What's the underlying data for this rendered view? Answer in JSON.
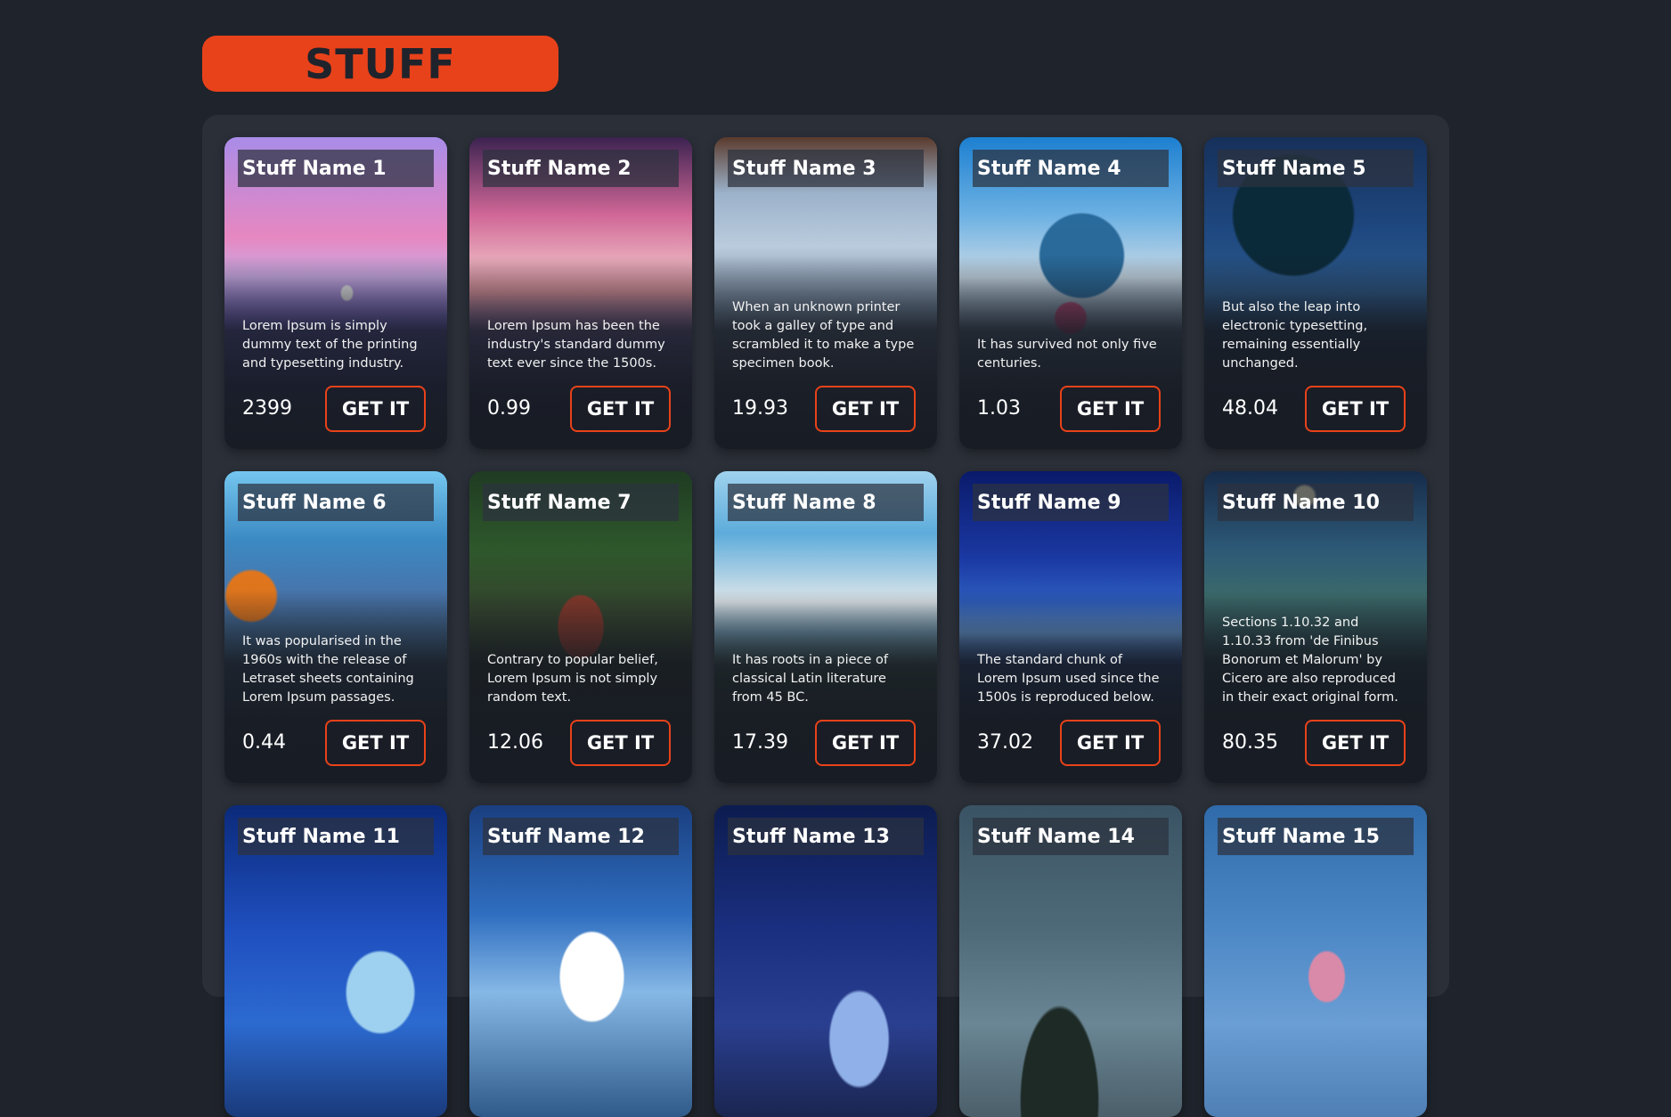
{
  "header": {
    "title": "STUFF"
  },
  "colors": {
    "accent": "#e8421a",
    "background": "#1f232b",
    "panel": "#2a2f38"
  },
  "cards": [
    {
      "name": "Stuff Name 1",
      "description": "Lorem Ipsum is simply dummy text of the printing and typesetting industry.",
      "price": "2399",
      "button": "GET IT"
    },
    {
      "name": "Stuff Name 2",
      "description": "Lorem Ipsum has been the industry's standard dummy text ever since the 1500s.",
      "price": "0.99",
      "button": "GET IT"
    },
    {
      "name": "Stuff Name 3",
      "description": "When an unknown printer took a galley of type and scrambled it to make a type specimen book.",
      "price": "19.93",
      "button": "GET IT"
    },
    {
      "name": "Stuff Name 4",
      "description": "It has survived not only five centuries.",
      "price": "1.03",
      "button": "GET IT"
    },
    {
      "name": "Stuff Name 5",
      "description": "But also the leap into electronic typesetting, remaining essentially unchanged.",
      "price": "48.04",
      "button": "GET IT"
    },
    {
      "name": "Stuff Name 6",
      "description": "It was popularised in the 1960s with the release of Letraset sheets containing Lorem Ipsum passages.",
      "price": "0.44",
      "button": "GET IT"
    },
    {
      "name": "Stuff Name 7",
      "description": "Contrary to popular belief, Lorem Ipsum is not simply random text.",
      "price": "12.06",
      "button": "GET IT"
    },
    {
      "name": "Stuff Name 8",
      "description": "It has roots in a piece of classical Latin literature from 45 BC.",
      "price": "17.39",
      "button": "GET IT"
    },
    {
      "name": "Stuff Name 9",
      "description": "The standard chunk of Lorem Ipsum used since the 1500s is reproduced below.",
      "price": "37.02",
      "button": "GET IT"
    },
    {
      "name": "Stuff Name 10",
      "description": "Sections 1.10.32 and 1.10.33 from 'de Finibus Bonorum et Malorum' by Cicero are also reproduced in their exact original form.",
      "price": "80.35",
      "button": "GET IT"
    },
    {
      "name": "Stuff Name 11"
    },
    {
      "name": "Stuff Name 12"
    },
    {
      "name": "Stuff Name 13"
    },
    {
      "name": "Stuff Name 14"
    },
    {
      "name": "Stuff Name 15"
    }
  ]
}
